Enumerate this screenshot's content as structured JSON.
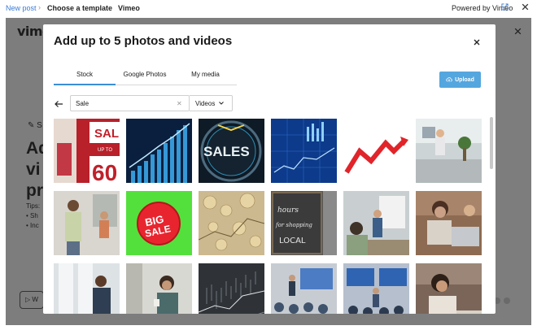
{
  "topbar": {
    "breadcrumb": [
      "New post",
      "Choose a template",
      "Vimeo"
    ],
    "powered_by": "Powered by Vimeo"
  },
  "backdrop": {
    "logo": "vimeo",
    "wand_text": "S",
    "heading_lines": [
      "Ad",
      "vi",
      "pr"
    ],
    "tips_label": "Tips:",
    "tips_items": [
      "Sh",
      "Inc"
    ],
    "button_label": "W"
  },
  "modal": {
    "title": "Add up to 5 photos and videos",
    "tabs": [
      {
        "label": "Stock",
        "active": true
      },
      {
        "label": "Google Photos",
        "active": false
      },
      {
        "label": "My media",
        "active": false
      }
    ],
    "upload_label": "Upload",
    "search": {
      "value": "Sale",
      "placeholder": "Search"
    },
    "filter": {
      "selected": "Videos"
    },
    "thumbnails": [
      {
        "subject": "sale-shop-window",
        "text_lines": [
          "SAL",
          "UP TO",
          "60"
        ],
        "bg": "#b8202a"
      },
      {
        "subject": "blue-bar-growth",
        "text_lines": [],
        "bg": "#0a1f3d"
      },
      {
        "subject": "sales-dial",
        "text_lines": [
          "SALES"
        ],
        "bg": "#0e1a26"
      },
      {
        "subject": "blue-chart-grid",
        "text_lines": [],
        "bg": "#0d3a8a"
      },
      {
        "subject": "red-zigzag-arrow",
        "text_lines": [],
        "bg": "#ffffff"
      },
      {
        "subject": "woman-presenting-office",
        "text_lines": [],
        "bg": "#cdd4d6"
      },
      {
        "subject": "man-shopping",
        "text_lines": [],
        "bg": "#d9d5cf"
      },
      {
        "subject": "big-sale-badge",
        "text_lines": [
          "BIG",
          "SALE"
        ],
        "bg": "#53e03c"
      },
      {
        "subject": "coins-and-charts",
        "text_lines": [],
        "bg": "#cdb98f"
      },
      {
        "subject": "chalkboard-shopping",
        "text_lines": [
          "hours",
          "for shopping",
          "LOCAL"
        ],
        "bg": "#565656"
      },
      {
        "subject": "team-meeting-whiteboard",
        "text_lines": [],
        "bg": "#c9cfd0"
      },
      {
        "subject": "woman-laptop-smiling",
        "text_lines": [],
        "bg": "#8d6b52"
      },
      {
        "subject": "man-at-window",
        "text_lines": [],
        "bg": "#dde2e5"
      },
      {
        "subject": "woman-with-coffee",
        "text_lines": [],
        "bg": "#d8d8d2"
      },
      {
        "subject": "stock-chart-screen",
        "text_lines": [],
        "bg": "#2f3338"
      },
      {
        "subject": "conference-presentation",
        "text_lines": [],
        "bg": "#c7ccd3"
      },
      {
        "subject": "business-meeting-screen",
        "text_lines": [],
        "bg": "#b5bfcd"
      },
      {
        "subject": "woman-writing",
        "text_lines": [],
        "bg": "#7a6558"
      }
    ]
  },
  "colors": {
    "accent": "#3a8fd6",
    "upload_button": "#54a6df",
    "backdrop": "#7d7d7d",
    "link": "#3a7bd5"
  }
}
